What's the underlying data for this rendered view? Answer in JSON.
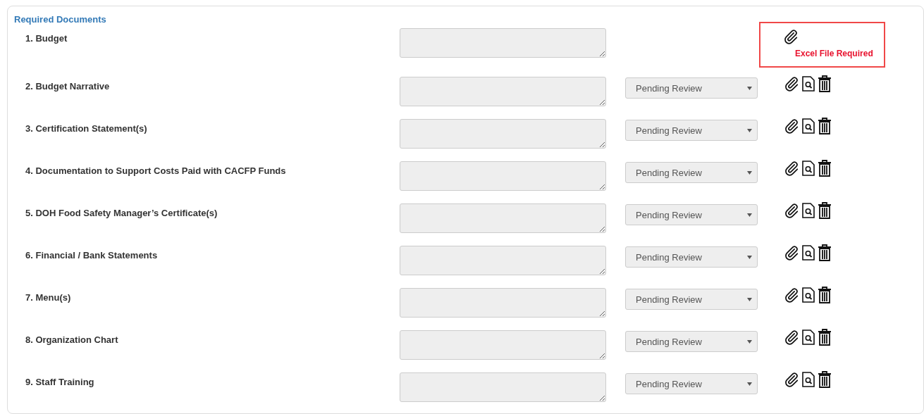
{
  "panel": {
    "title": "Required Documents"
  },
  "documents": [
    {
      "kind": "upload_required",
      "label": "1. Budget",
      "error": "Excel File Required"
    },
    {
      "kind": "review",
      "label": "2. Budget Narrative",
      "status": "Pending Review"
    },
    {
      "kind": "review",
      "label": "3. Certification Statement(s)",
      "status": "Pending Review"
    },
    {
      "kind": "review",
      "label": "4. Documentation to Support Costs Paid with CACFP Funds",
      "status": "Pending Review"
    },
    {
      "kind": "review",
      "label": "5. DOH Food Safety Manager’s Certificate(s)",
      "status": "Pending Review"
    },
    {
      "kind": "review",
      "label": "6. Financial / Bank Statements",
      "status": "Pending Review"
    },
    {
      "kind": "review",
      "label": "7. Menu(s)",
      "status": "Pending Review"
    },
    {
      "kind": "review",
      "label": "8. Organization Chart",
      "status": "Pending Review"
    },
    {
      "kind": "review",
      "label": "9. Staff Training",
      "status": "Pending Review"
    }
  ]
}
